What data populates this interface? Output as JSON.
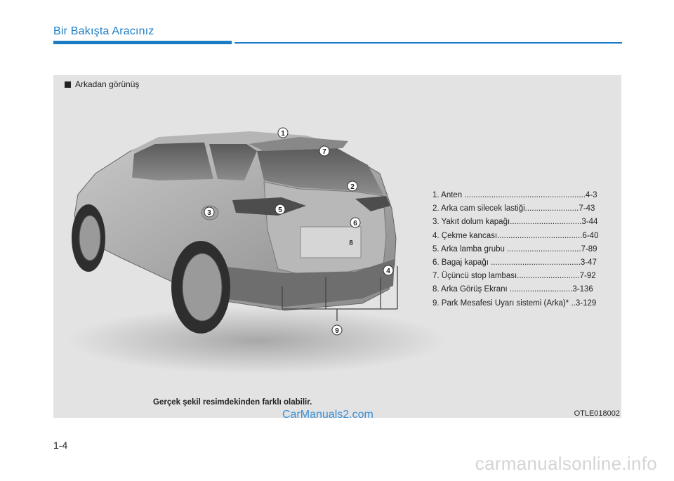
{
  "header": {
    "section_title": "Bir Bakışta Aracınız"
  },
  "figure": {
    "caption": "Arkadan görünüş",
    "callouts": [
      "1",
      "2",
      "3",
      "4",
      "5",
      "6",
      "7",
      "8",
      "9"
    ],
    "legend": [
      "1.  Anten ......................................................4-3",
      "2.  Arka cam silecek lastiği........................7-43",
      "3. Yakıt dolum kapağı................................3-44",
      "4. Çekme kancası......................................6-40",
      "5.  Arka lamba grubu .................................7-89",
      "6.  Bagaj kapağı ........................................3-47",
      "7.  Üçüncü stop lambası............................7-92",
      "8.  Arka Görüş Ekranı  ............................3-136",
      "9.  Park Mesafesi Uyarı sistemi (Arka)* ..3-129"
    ],
    "disclaimer": "Gerçek şekil resimdekinden farklı olabilir.",
    "code": "OTLE018002"
  },
  "watermark": "CarManuals2.com",
  "page_number": "1-4",
  "footer_watermark": "carmanualsonline.info",
  "colors": {
    "accent": "#1a7cc4",
    "panel": "#e3e3e3"
  }
}
